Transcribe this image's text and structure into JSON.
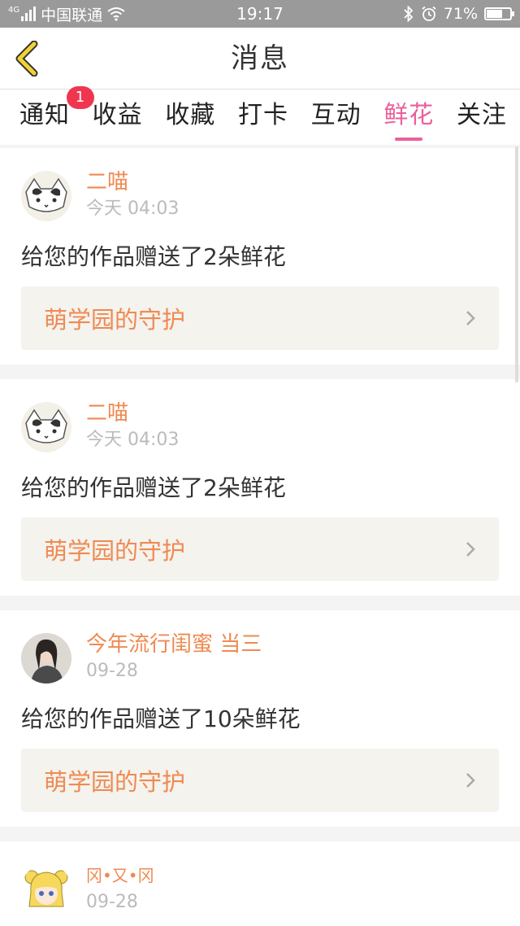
{
  "status": {
    "carrier": "中国联通",
    "signal_prefix": "4G",
    "time": "19:17",
    "battery": "71%",
    "battery_level": 0.71
  },
  "nav": {
    "title": "消息",
    "back_icon": "chevron-left-icon"
  },
  "colors": {
    "accent_pink": "#e8609c",
    "user_orange": "#ef8a52",
    "badge_red": "#f0364f"
  },
  "tabs": [
    {
      "label": "通知",
      "badge": "1"
    },
    {
      "label": "收益"
    },
    {
      "label": "收藏"
    },
    {
      "label": "打卡"
    },
    {
      "label": "互动"
    },
    {
      "label": "鲜花",
      "active": true
    },
    {
      "label": "关注"
    }
  ],
  "items": [
    {
      "user": "二喵",
      "time": "今天 04:03",
      "message": "给您的作品赠送了2朵鲜花",
      "work": "萌学园的守护",
      "avatar_icon": "cat-avatar"
    },
    {
      "user": "二喵",
      "time": "今天 04:03",
      "message": "给您的作品赠送了2朵鲜花",
      "work": "萌学园的守护",
      "avatar_icon": "cat-avatar"
    },
    {
      "user": "今年流行闺蜜 当三",
      "time": "09-28",
      "message": "给您的作品赠送了10朵鲜花",
      "work": "萌学园的守护",
      "avatar_icon": "girl-photo-avatar"
    },
    {
      "user": "冈•又•冈",
      "time": "09-28",
      "message": "",
      "work": "",
      "avatar_icon": "anime-girl-avatar"
    }
  ]
}
